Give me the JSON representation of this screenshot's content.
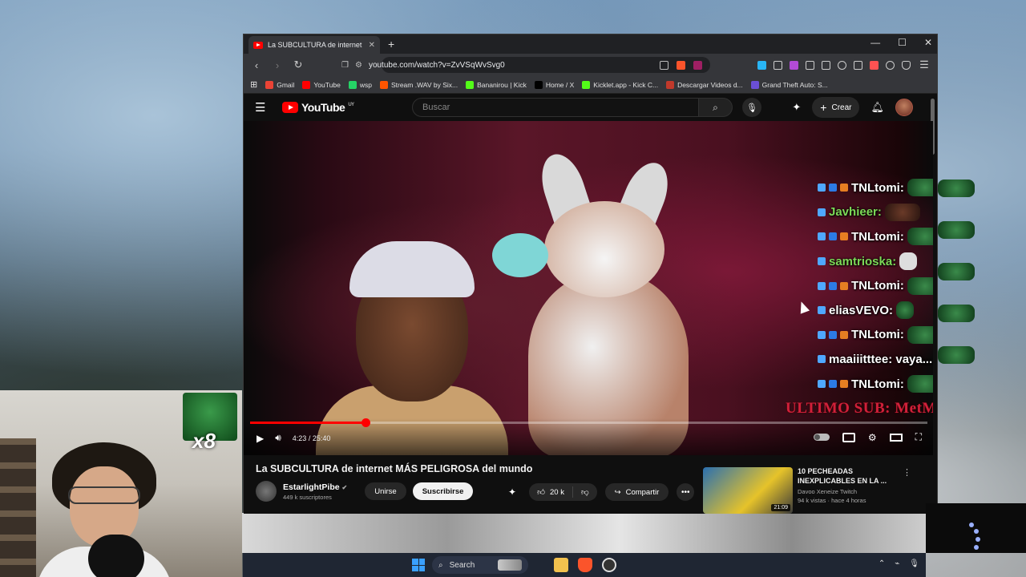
{
  "browser": {
    "tab_title": "La SUBCULTURA de internet MÁ",
    "new_tab": "+",
    "url": "youtube.com/watch?v=ZvVSqWvSvg0",
    "window_controls": {
      "minimize": "—",
      "maximize": "☐",
      "close": "✕"
    }
  },
  "bookmarks": [
    {
      "label": "Gmail",
      "color": "#ea4335"
    },
    {
      "label": "YouTube",
      "color": "#ff0000"
    },
    {
      "label": "wsp",
      "color": "#25d366"
    },
    {
      "label": "Stream .WAV by Six...",
      "color": "#ff5500"
    },
    {
      "label": "Bananirou | Kick",
      "color": "#53fc18"
    },
    {
      "label": "Home / X",
      "color": "#000000"
    },
    {
      "label": "Kicklet.app - Kick C...",
      "color": "#53fc18"
    },
    {
      "label": "Descargar Videos d...",
      "color": "#c0392b"
    },
    {
      "label": "Grand Theft Auto: S...",
      "color": "#6a4fd6"
    }
  ],
  "youtube": {
    "logo_text": "YouTube",
    "country": "UY",
    "search_placeholder": "Buscar",
    "create_label": "Crear"
  },
  "player": {
    "time": "4:23 / 25:40",
    "progress": 0.171
  },
  "chat": [
    {
      "name": "TNLtomi:",
      "color": "white",
      "emote": "green"
    },
    {
      "name": "Javhieer:",
      "color": "green",
      "emote": "face"
    },
    {
      "name": "TNLtomi:",
      "color": "white",
      "emote": "green"
    },
    {
      "name": "samtrioska:",
      "color": "green",
      "emote": "pic"
    },
    {
      "name": "TNLtomi:",
      "color": "white",
      "emote": "green"
    },
    {
      "name": "eliasVEVO:",
      "color": "white",
      "emote": "small"
    },
    {
      "name": "TNLtomi:",
      "color": "white",
      "emote": "green"
    },
    {
      "name": "maaiiitttee: vaya...",
      "color": "white",
      "emote": ""
    },
    {
      "name": "TNLtomi:",
      "color": "white",
      "emote": "green"
    }
  ],
  "overlay": {
    "last_sub": "ULTIMO SUB: MetMarceloA",
    "multiplier": "x8"
  },
  "video": {
    "title": "La SUBCULTURA de internet MÁS PELIGROSA del mundo",
    "channel": "EstarlightPibe",
    "subscribers": "449 k suscriptores",
    "join_label": "Unirse",
    "subscribe_label": "Suscribirse",
    "likes": "20 k",
    "share_label": "Compartir"
  },
  "recommended": {
    "title": "10 PECHEADAS INEXPLICABLES EN LA ...",
    "channel": "Davoo Xeneize Twitch",
    "meta": "94 k vistas · hace 4 horas",
    "duration": "21:09"
  },
  "taskbar": {
    "search_label": "Search"
  }
}
